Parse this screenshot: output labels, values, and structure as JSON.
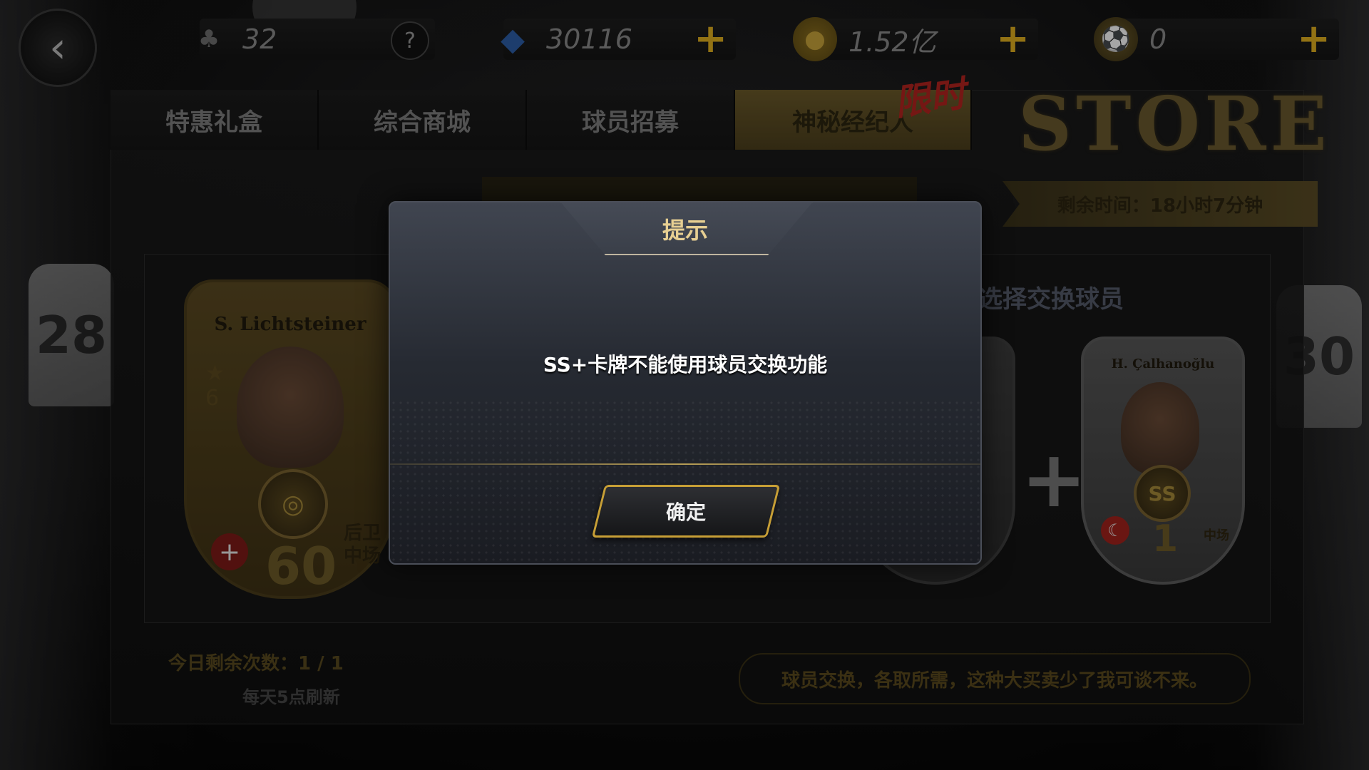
{
  "topbar": {
    "clover_value": "32",
    "help_icon": "?",
    "gems_value": "30116",
    "coins_value": "1.52亿",
    "ball_value": "0"
  },
  "tabs": [
    {
      "label": "特惠礼盒"
    },
    {
      "label": "综合商城"
    },
    {
      "label": "球员招募"
    },
    {
      "label": "神秘经纪人"
    }
  ],
  "limited_label": "限时",
  "store_logo": "STORE",
  "timer_text": "剩余时间：18小时7分钟",
  "select_label": "选择交换球员",
  "cards": {
    "left": {
      "name": "S. Lichtsteiner",
      "level": "6",
      "rating": "60",
      "positions": "后卫\n中场"
    },
    "right": {
      "name": "H. Çalhanoğlu",
      "badge": "SS",
      "rating": "1",
      "position": "中场"
    }
  },
  "remaining_today": "今日剩余次数：1 / 1",
  "refresh_note": "每天5点刷新",
  "quote": "球员交换，各取所需，这种大买卖少了我可谈不来。",
  "modal": {
    "title": "提示",
    "message": "SS+卡牌不能使用球员交换功能",
    "ok_label": "确定"
  },
  "icons": {
    "back": "chevron-left-icon",
    "clover": "clover-icon",
    "gem": "gem-icon",
    "coin": "coin-icon",
    "ball": "football-icon",
    "plus": "plus-icon"
  },
  "colors": {
    "accent_gold": "#e0b020",
    "modal_title": "#e7cf92",
    "button_border": "#c79f36"
  }
}
